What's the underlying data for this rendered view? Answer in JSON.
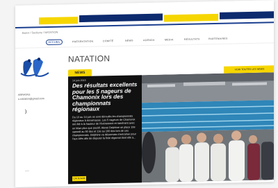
{
  "breadcrumb": "Ewen / Sections / NATATION",
  "nav": {
    "home": "ACCUEIL",
    "items": [
      "PRESENTATION",
      "COMITÉ",
      "NEWS",
      "AGENDA",
      "MEDIA",
      "RÉSULTATS",
      "PARTENAIRES"
    ]
  },
  "contact": {
    "line1": "ARRATAS",
    "line2": "u.natation@gmail.com"
  },
  "page_title": "NATATION",
  "news_badge": "NEWS",
  "all_news": "VOIR TOUTES LES NEWS",
  "article": {
    "date": "14 juin 2015",
    "title": "Des résultats excellents pour les 5 nageurs de Chamonix lors des championnats régionaux",
    "body": "Du 13 au 14 juin se sont déroulés les championnats régionaux à Annemasse. Les 5 nageurs de Chamonix ont été à la hauteur de l'événement et ramènent avec un bilan plus que positif. Alexei Delphine se place 10e samedi au 50 dos et 13e au 100 dos lors de ces championnats. Delphine va désormais s'entraîner pour l'aux Alés afin de disputer la finle régional dont elle a...",
    "read_more": "Lire la suite"
  },
  "colors": {
    "accent_yellow": "#f6d600",
    "brand_navy": "#0c2a6e",
    "panel_black": "#111111"
  }
}
